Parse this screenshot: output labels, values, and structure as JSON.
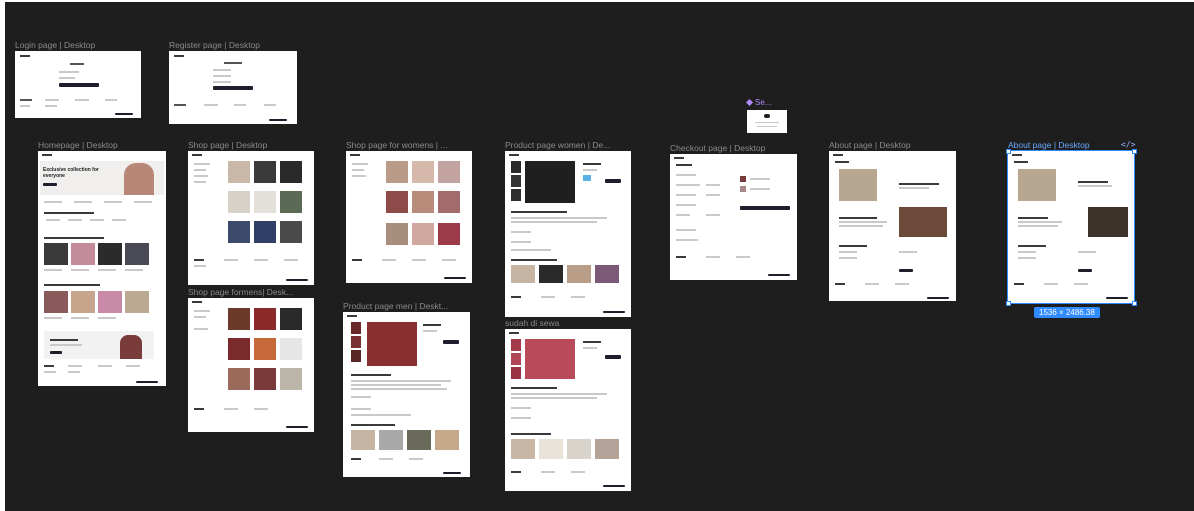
{
  "frames": {
    "login": "Login page | Desktop",
    "register": "Register page | Desktop",
    "homepage": "Homepage | Desktop",
    "shop": "Shop page | Desktop",
    "shop_women": "Shop page for womens | ...",
    "product_women": "Product page women | De...",
    "checkout": "Checkout page | Desktop",
    "about1": "About page | Desktop",
    "about2": "About page | Desktop",
    "shop_men": "Shop page formens| Desk...",
    "product_men": "Product page men | Deskt...",
    "sudah": "sudah di sewa",
    "component": "Se..."
  },
  "selection": {
    "dimensions": "1536 × 2486.38",
    "code_icon": "</>"
  },
  "thumbs": {
    "homepage_hero": "Exclusive collection for everyone"
  },
  "colors": {
    "canvas": "#1e1e1e",
    "selection": "#2f8bff",
    "component": "#b28bff",
    "label": "#8a8a8a"
  }
}
